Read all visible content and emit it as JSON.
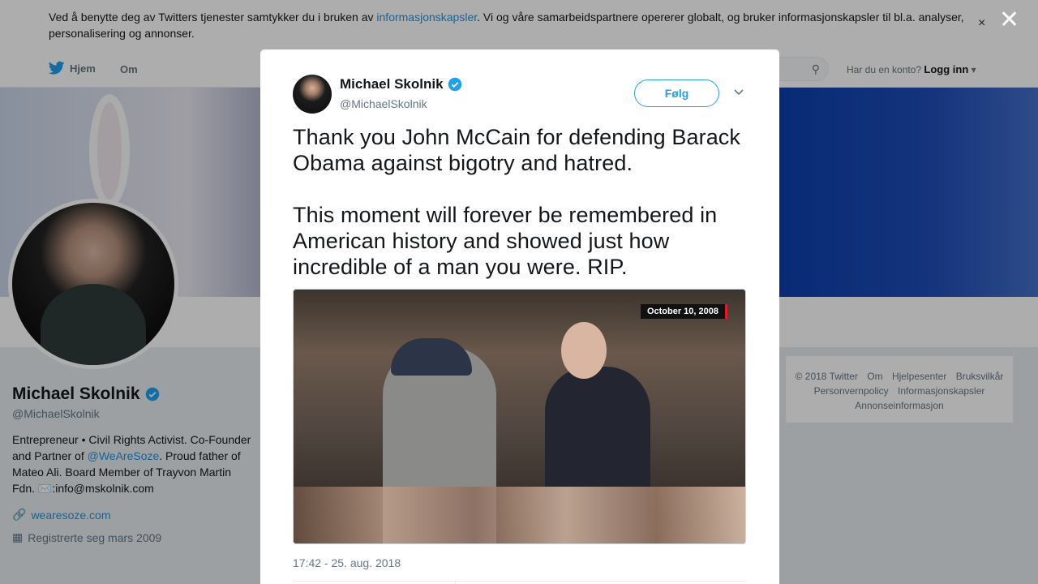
{
  "cookie_bar": {
    "text_before": "Ved å benytte deg av Twitters tjenester samtykker du i bruken av ",
    "link": "informasjonskapsler",
    "text_after": ". Vi og våre samarbeidspartnere opererer globalt, og bruker informasjonskapsler til bl.a. analyser, personalisering og annonser.",
    "close": "×"
  },
  "nav": {
    "home": "Hjem",
    "about": "Om",
    "login_prompt": "Har du en konto?",
    "login": "Logg inn"
  },
  "profile": {
    "name": "Michael Skolnik",
    "handle": "@MichaelSkolnik",
    "bio_1": "Entrepreneur • Civil Rights Activist. Co-Founder and Partner of ",
    "bio_mention": "@WeAreSoze",
    "bio_2": ". Proud father of Mateo Ali. Board Member of Trayvon Martin Fdn. ✉️:info@mskolnik.com",
    "url": "wearesoze.com",
    "joined": "Registrerte seg mars 2009"
  },
  "footer": {
    "links": [
      "© 2018 Twitter",
      "Om",
      "Hjelpesenter",
      "Bruksvilkår",
      "Personvernpolicy",
      "Informasjonskapsler",
      "Annonseinformasjon"
    ]
  },
  "modal": {
    "close": "✕",
    "author_name": "Michael Skolnik",
    "author_handle": "@MichaelSkolnik",
    "follow_label": "Følg",
    "caret": "⌄",
    "tweet_p1": "Thank you John McCain for defending Barack Obama against bigotry and hatred.",
    "tweet_p2": "This moment will forever be remembered in American history and showed just how incredible of a man you were. RIP.",
    "media_date_badge": "October 10, 2008",
    "timestamp": "17:42 - 25. aug. 2018"
  },
  "colors": {
    "accent": "#1da1f2",
    "link": "#1b95e0",
    "muted": "#657786"
  }
}
